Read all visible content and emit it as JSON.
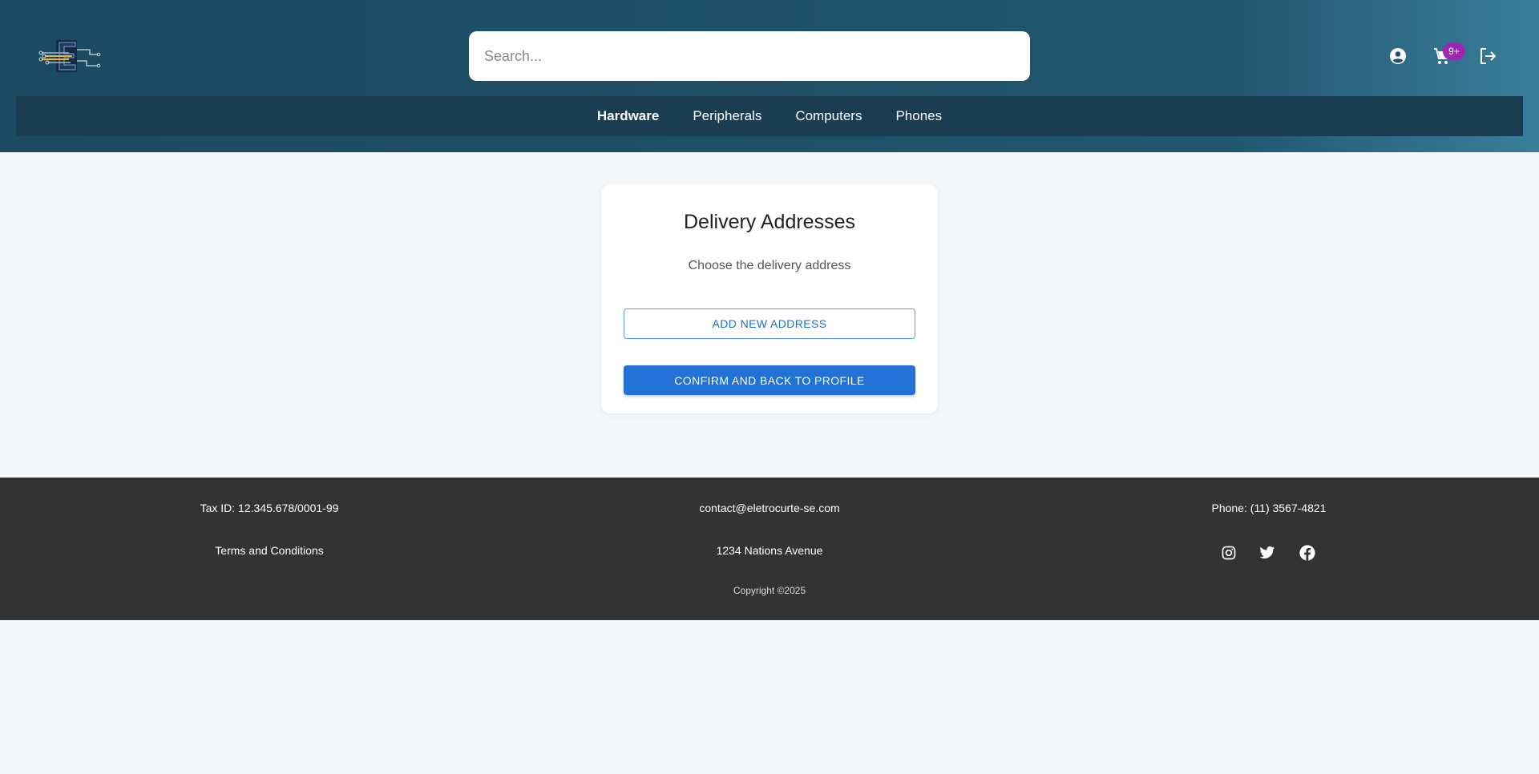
{
  "header": {
    "search_placeholder": "Search...",
    "cart_badge": "9+",
    "nav": [
      {
        "label": "Hardware",
        "active": true
      },
      {
        "label": "Peripherals",
        "active": false
      },
      {
        "label": "Computers",
        "active": false
      },
      {
        "label": "Phones",
        "active": false
      }
    ],
    "icons": [
      "account-circle-icon",
      "shopping-cart-icon",
      "logout-icon"
    ]
  },
  "card": {
    "title": "Delivery Addresses",
    "subtitle": "Choose the delivery address",
    "add_button": "ADD NEW ADDRESS",
    "confirm_button": "CONFIRM AND BACK TO PROFILE"
  },
  "footer": {
    "tax_id": "Tax ID: 12.345.678/0001-99",
    "email": "contact@eletrocurte-se.com",
    "phone": "Phone: (11) 3567-4821",
    "terms": "Terms and Conditions",
    "address": "1234 Nations Avenue",
    "copyright": "Copyright ©2025",
    "social_icons": [
      "instagram-icon",
      "twitter-icon",
      "facebook-icon"
    ]
  },
  "colors": {
    "header_bg": "#1f5169",
    "nav_bg": "#1a3d51",
    "badge": "#9c27b0",
    "primary": "#2272d6",
    "footer_bg": "#333333",
    "page_bg": "#f4f8fa"
  }
}
